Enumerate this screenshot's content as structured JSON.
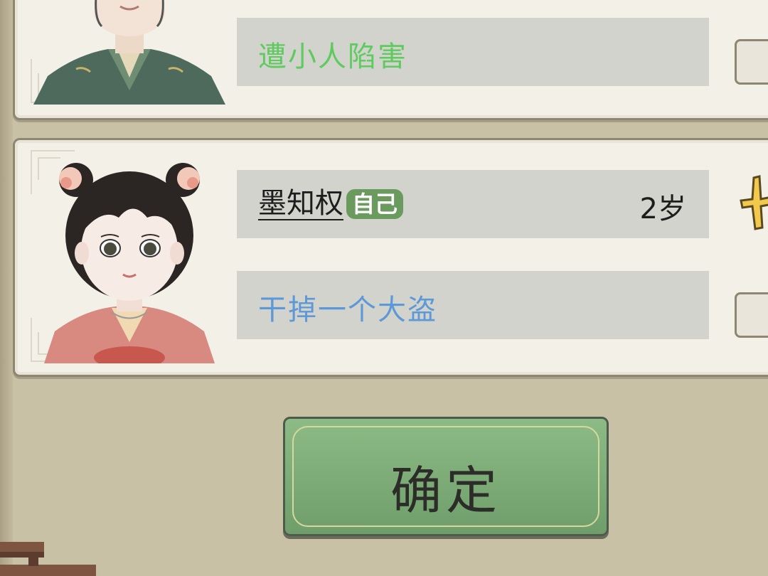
{
  "cards": [
    {
      "goal": "遭小人陷害",
      "goal_color": "#5fcb5f"
    },
    {
      "name": "墨知权",
      "badge": "自己",
      "age": "2岁",
      "goal": "干掉一个大盗",
      "goal_color": "#5d98d7"
    }
  ],
  "confirm_button": {
    "label": "确定"
  },
  "colors": {
    "panel": "#f3f0e8",
    "info_bar": "#d3d3ce",
    "confirm_green": "#7fae79",
    "self_badge": "#6a9a5e"
  }
}
